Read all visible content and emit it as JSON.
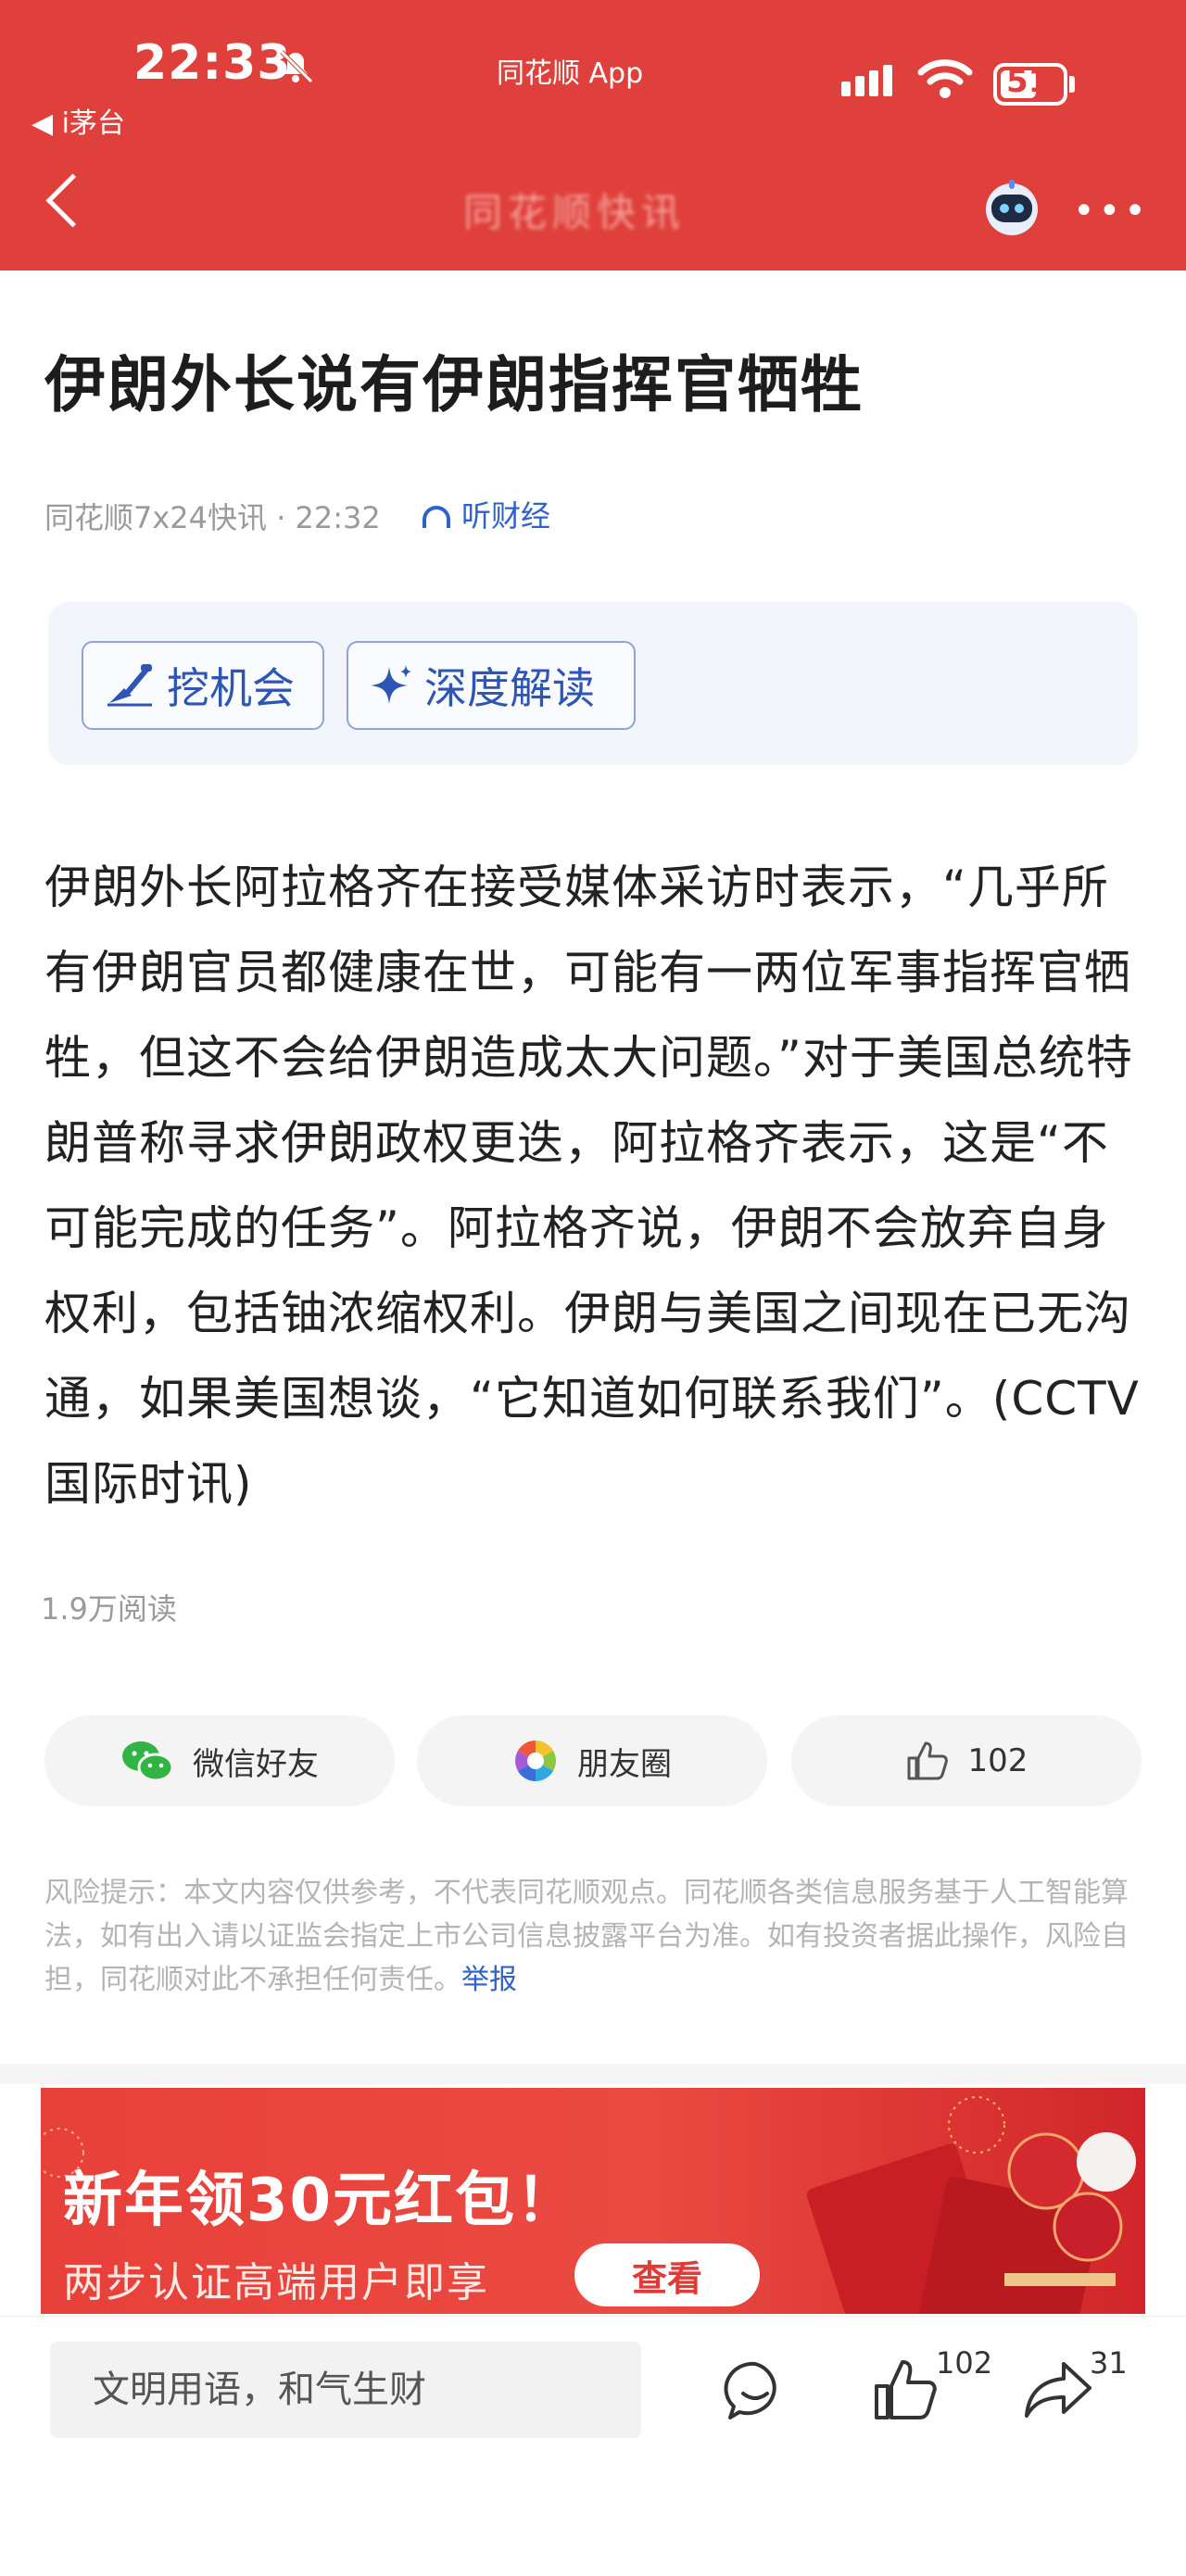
{
  "status_bar": {
    "time": "22:33",
    "app_badge": "同花顺 App",
    "back_app": "◀ i茅台",
    "battery": "51"
  },
  "nav": {
    "title": "同花顺快讯"
  },
  "article": {
    "title": "伊朗外长说有伊朗指挥官牺牲",
    "meta": "同花顺7x24快讯 · 22:32",
    "listen_label": "听财经",
    "ai_buttons": [
      "挖机会",
      "深度解读"
    ],
    "body": "伊朗外长阿拉格齐在接受媒体采访时表示，“几乎所有伊朗官员都健康在世，可能有一两位军事指挥官牺牲，但这不会给伊朗造成太大问题。”对于美国总统特朗普称寻求伊朗政权更迭，阿拉格齐表示，这是“不可能完成的任务”。阿拉格齐说，伊朗不会放弃自身权利，包括铀浓缩权利。伊朗与美国之间现在已无沟通，如果美国想谈，“它知道如何联系我们”。(CCTV国际时讯)",
    "reads": "1.9万阅读"
  },
  "share": {
    "wechat": "微信好友",
    "moments": "朋友圈",
    "like_count": "102"
  },
  "risk": {
    "text": "风险提示：本文内容仅供参考，不代表同花顺观点。同花顺各类信息服务基于人工智能算法，如有出入请以证监会指定上市公司信息披露平台为准。如有投资者据此操作，风险自担，同花顺对此不承担任何责任。",
    "report_link": "举报"
  },
  "banner": {
    "title": "新年领30元红包！",
    "subtitle": "两步认证高端用户即享",
    "button": "查看"
  },
  "bottom_bar": {
    "comment_placeholder": "文明用语，和气生财",
    "like_count": "102",
    "share_count": "31"
  },
  "colors": {
    "brand_red": "#e0403b",
    "link_blue": "#2f62c8"
  }
}
